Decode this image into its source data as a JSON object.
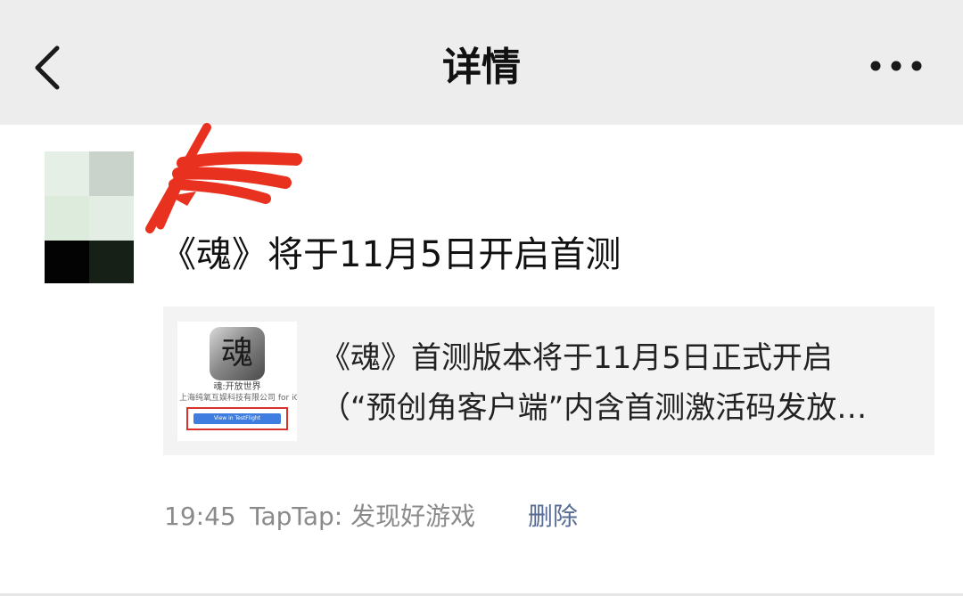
{
  "header": {
    "title": "详情",
    "back_icon": "chevron-left-icon",
    "more_icon": "more-dots-icon"
  },
  "post": {
    "avatar_icon": "pixelated-avatar",
    "text": "《魂》将于11月5日开启首测",
    "link_card": {
      "title_line_1": "《魂》首测版本将于11月5日正式开启",
      "title_line_2": "（“预创角客户端”内含首测激活码发放…",
      "thumbnail": {
        "icon_glyph": "魂",
        "app_name": "魂:开放世界",
        "developer": "上海纯氧互娱科技有限公司 for iOS",
        "button_label": "View in TestFlight"
      }
    },
    "meta": {
      "time": "19:45",
      "source": "TapTap: 发现好游戏",
      "delete_label": "删除"
    }
  },
  "colors": {
    "header_bg": "#ededed",
    "link_blue": "#576b95",
    "meta_gray": "#8a8a8a",
    "card_bg": "#f3f3f3",
    "redaction_red": "#e8321f"
  }
}
